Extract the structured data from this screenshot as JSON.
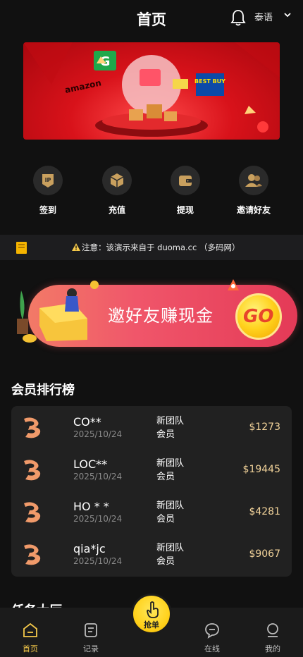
{
  "header": {
    "title": "首页",
    "language": "泰语"
  },
  "banner": {
    "brands": [
      "amazon",
      "G",
      "BEST BUY"
    ]
  },
  "quick_actions": [
    {
      "label": "签到",
      "icon": "ip-icon"
    },
    {
      "label": "充值",
      "icon": "box-icon"
    },
    {
      "label": "提现",
      "icon": "wallet-icon"
    },
    {
      "label": "邀请好友",
      "icon": "users-icon"
    }
  ],
  "notice": {
    "text": "注意：该演示来自于 duoma.cc （多码网）"
  },
  "invite": {
    "text": "邀好友赚现金",
    "go": "GO"
  },
  "ranking": {
    "title": "会员排行榜",
    "rows": [
      {
        "name": "CO**",
        "date": "2025/10/24",
        "type": "新团队会员",
        "amount": "$1273"
      },
      {
        "name": "LOC**",
        "date": "2025/10/24",
        "type": "新团队会员",
        "amount": "$19445"
      },
      {
        "name": "HO * *",
        "date": "2025/10/24",
        "type": "新团队会员",
        "amount": "$4281"
      },
      {
        "name": "qia*jc",
        "date": "2025/10/24",
        "type": "新团队会员",
        "amount": "$9067"
      }
    ]
  },
  "next_section": {
    "title": "任务大厅"
  },
  "tabbar": {
    "home": "首页",
    "records": "记录",
    "grab": "抢单",
    "online": "在线",
    "mine": "我的"
  },
  "colors": {
    "accent": "#f5c94a",
    "background": "#111111",
    "card": "#212121",
    "amount": "#f2d39a"
  }
}
